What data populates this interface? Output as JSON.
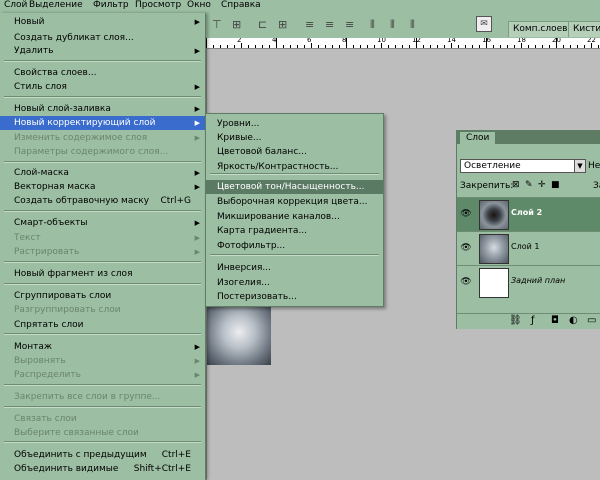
{
  "menubar": {
    "items": [
      "Слой",
      "Выделение",
      "Фильтр",
      "Просмотр",
      "Окно",
      "Справка"
    ]
  },
  "toolbar": {
    "tabs": [
      "Комп.слоев",
      "Кисти"
    ]
  },
  "ruler": {
    "labels": [
      "2",
      "4",
      "6",
      "8",
      "10",
      "12",
      "14",
      "16",
      "18",
      "20",
      "22"
    ]
  },
  "layer_menu": {
    "items": [
      {
        "label": "Новый",
        "arrow": true
      },
      {
        "label": "Создать дубликат слоя..."
      },
      {
        "label": "Удалить",
        "arrow": true
      },
      {
        "label": "Свойства слоев..."
      },
      {
        "label": "Стиль слоя",
        "arrow": true
      },
      {
        "label": "Новый слой-заливка",
        "arrow": true
      },
      {
        "label": "Новый корректирующий слой",
        "arrow": true,
        "highlighted": true
      },
      {
        "label": "Изменить содержимое слоя",
        "arrow": true,
        "disabled": true
      },
      {
        "label": "Параметры содержимого слоя...",
        "disabled": true
      },
      {
        "label": "Слой-маска",
        "arrow": true
      },
      {
        "label": "Векторная маска",
        "arrow": true
      },
      {
        "label": "Создать обтравочную маску",
        "shortcut": "Ctrl+G"
      },
      {
        "label": "Смарт-объекты",
        "arrow": true
      },
      {
        "label": "Текст",
        "arrow": true,
        "disabled": true
      },
      {
        "label": "Растрировать",
        "arrow": true,
        "disabled": true
      },
      {
        "label": "Новый фрагмент из слоя"
      },
      {
        "label": "Сгруппировать слои"
      },
      {
        "label": "Разгруппировать слои",
        "disabled": true
      },
      {
        "label": "Спрятать слои"
      },
      {
        "label": "Монтаж",
        "arrow": true
      },
      {
        "label": "Выровнять",
        "arrow": true,
        "disabled": true
      },
      {
        "label": "Распределить",
        "arrow": true,
        "disabled": true
      },
      {
        "label": "Закрепить все слои в группе...",
        "disabled": true
      },
      {
        "label": "Связать слои",
        "disabled": true
      },
      {
        "label": "Выберите связанные слои",
        "disabled": true
      },
      {
        "label": "Объединить с предыдущим",
        "shortcut": "Ctrl+E"
      },
      {
        "label": "Объединить видимые",
        "shortcut": "Shift+Ctrl+E"
      }
    ]
  },
  "adjust_submenu": {
    "items": [
      {
        "label": "Уровни..."
      },
      {
        "label": "Кривые..."
      },
      {
        "label": "Цветовой баланс..."
      },
      {
        "label": "Яркость/Контрастность..."
      },
      {
        "label": "Цветовой тон/Насыщенность...",
        "highlighted": true
      },
      {
        "label": "Выборочная коррекция цвета..."
      },
      {
        "label": "Микширование каналов..."
      },
      {
        "label": "Карта градиента..."
      },
      {
        "label": "Фотофильтр..."
      },
      {
        "label": "Инверсия..."
      },
      {
        "label": "Изогелия..."
      },
      {
        "label": "Постеризовать..."
      }
    ]
  },
  "layers_panel": {
    "tab": "Слои",
    "blend_mode": "Осветление",
    "opacity_label": "Неп",
    "lock_label": "Закрепить:",
    "fill_label": "За",
    "layers": [
      {
        "name": "Слой 2",
        "selected": true
      },
      {
        "name": "Слой 1"
      },
      {
        "name": "Задний план"
      }
    ]
  },
  "colors": {
    "ui_green": "#9cbea2",
    "menu_highlight": "#3a6ccd",
    "submenu_highlight": "#5a7a63",
    "selected_layer": "#5e8a6a"
  }
}
